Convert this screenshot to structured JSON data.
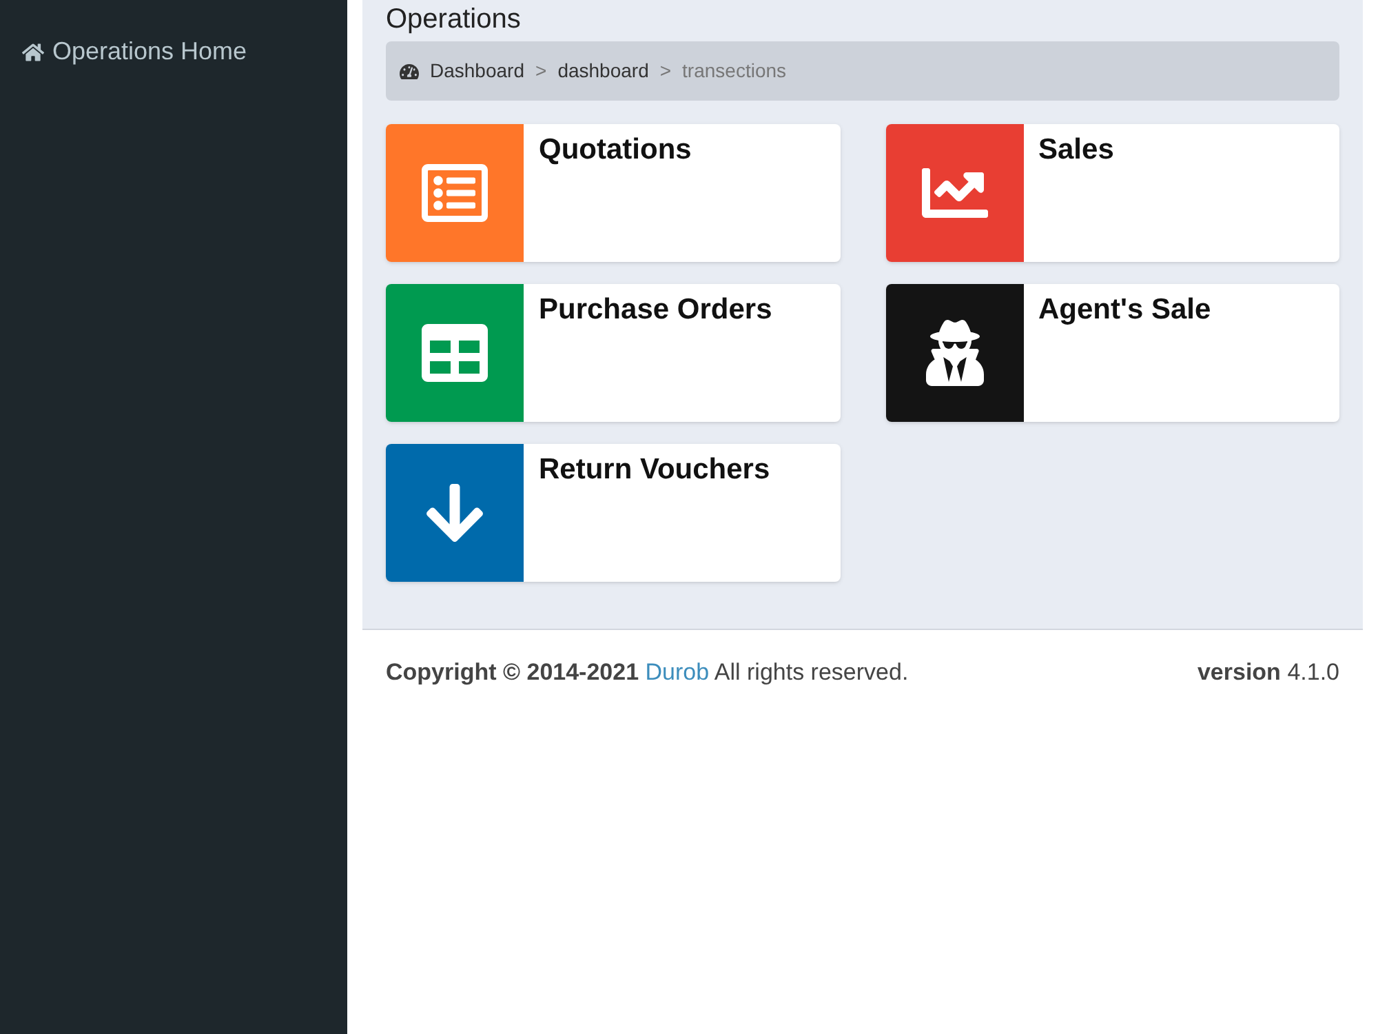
{
  "sidebar": {
    "items": [
      {
        "label": "Operations Home",
        "selected": false
      }
    ]
  },
  "page_title": "Operations",
  "breadcrumb": [
    {
      "label": "Dashboard"
    },
    {
      "label": "dashboard"
    },
    {
      "label": "transections"
    }
  ],
  "breadcrumb_separator": ">",
  "tiles": [
    {
      "title": "Quotations",
      "color": "#ff7629"
    },
    {
      "title": "Sales",
      "color": "#e83e33"
    },
    {
      "title": "Purchase Orders",
      "color": "#009a50"
    },
    {
      "title": "Agent's Sale",
      "color": "#141414"
    },
    {
      "title": "Return Vouchers",
      "color": "#006aab"
    }
  ],
  "footer": {
    "copyright": "Copyright © 2014-2021",
    "link": "Durob",
    "rights": "All rights reserved.",
    "version_label": "version",
    "version": "4.1.0"
  }
}
